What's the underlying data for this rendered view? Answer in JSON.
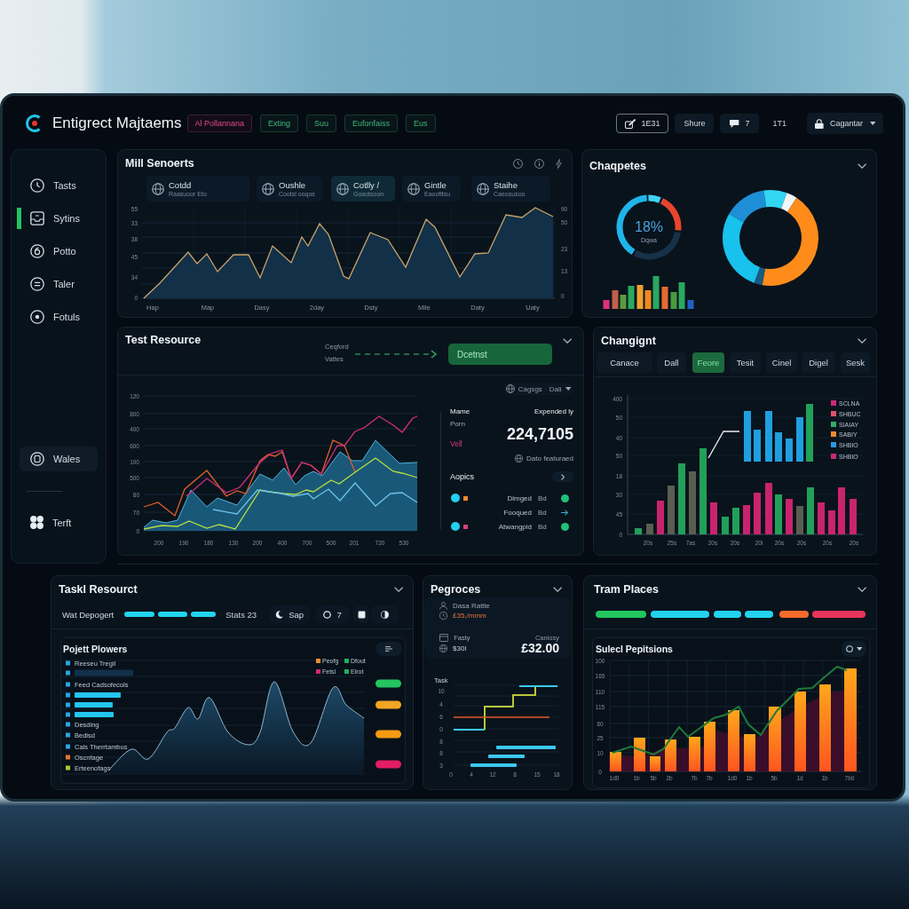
{
  "header": {
    "title": "Entigrect Majtaems",
    "tabs": [
      {
        "label": "Al Pollannana",
        "selected": true
      },
      {
        "label": "Exting",
        "selected": false
      },
      {
        "label": "Suu",
        "selected": false
      },
      {
        "label": "Eufonfaiss",
        "selected": false
      },
      {
        "label": "Eus",
        "selected": false
      }
    ],
    "toolbar": [
      {
        "kind": "outlined",
        "label": "1E31"
      },
      {
        "kind": "plain",
        "label": "Shure"
      },
      {
        "kind": "chat",
        "label": "7"
      },
      {
        "kind": "text",
        "label": "1T1"
      }
    ],
    "user_menu": {
      "label": "Cagantar"
    }
  },
  "sidebar": {
    "items": [
      {
        "label": "Tasts",
        "selected": false
      },
      {
        "label": "Sytins",
        "selected": true
      },
      {
        "label": "Potto",
        "selected": false
      },
      {
        "label": "Taler",
        "selected": false
      },
      {
        "label": "Fotuls",
        "selected": false
      }
    ],
    "bottom_items": [
      {
        "label": "Wales",
        "selected": true
      },
      {
        "label": "Terft",
        "selected": false
      }
    ]
  },
  "sensor_panel": {
    "title": "Mill Senoerts",
    "stats": [
      {
        "label": "Cotdd",
        "caption": "Raasuoor Eto",
        "selected": false
      },
      {
        "label": "Oushle",
        "caption": "Cootsl ooqos",
        "selected": false
      },
      {
        "label": "Cotlly /",
        "caption": "Goaotsoon",
        "selected": true
      },
      {
        "label": "Gintle",
        "caption": "Eaoofitsu",
        "selected": false
      },
      {
        "label": "Staihe",
        "caption": "Caeosusoo",
        "selected": false
      }
    ],
    "chart": {
      "y_ticks": [
        "55",
        "33",
        "38",
        "45",
        "34",
        "0"
      ],
      "y2_ticks": [
        "90",
        "50",
        "23",
        "13",
        "0"
      ],
      "x_labels": [
        "Hap",
        "Map",
        "Dasy",
        "2day",
        "Dsty",
        "Mile",
        "Daty",
        "Uaty"
      ]
    }
  },
  "chapter_panel": {
    "title": "Chaqpetes",
    "gauge": {
      "value": "18%",
      "caption": "Dqwa"
    }
  },
  "resource_panel": {
    "title": "Test Resource",
    "flow_labels": [
      "Ceqford",
      "Vattes"
    ],
    "action": "Dcetnst",
    "chart": {
      "y_ticks": [
        "120",
        "800",
        "400",
        "600",
        "100",
        "500",
        "80",
        "70",
        "0"
      ],
      "x_labels": [
        "200",
        "190",
        "180",
        "130",
        "200",
        "400",
        "700",
        "500",
        "201",
        "720",
        "530"
      ]
    },
    "filter": {
      "label": "Cagsgs",
      "value": "Dali"
    },
    "summary": {
      "name_label": "Mame",
      "column_label": "Expended ly",
      "name": "Porn",
      "status": "Vell",
      "amount": "224,7105",
      "note": "Dato featuraed"
    },
    "topics": {
      "title": "Aopics",
      "rows": [
        {
          "kind": "marked",
          "label": "Dimged",
          "value": "Bd",
          "color": "#f08a30"
        },
        {
          "kind": "plain",
          "label": "Fooqued",
          "value": "Bd"
        },
        {
          "kind": "marked",
          "label": "Atwangpid",
          "value": "Bd",
          "color": "#d8407a"
        }
      ]
    }
  },
  "change_panel": {
    "title": "Changignt",
    "tabs": [
      {
        "label": "Canace",
        "selected": false
      },
      {
        "label": "Dall",
        "selected": false
      },
      {
        "label": "Feore",
        "selected": true
      },
      {
        "label": "Tesit",
        "selected": false
      },
      {
        "label": "Cinel",
        "selected": false
      },
      {
        "label": "Digel",
        "selected": false
      },
      {
        "label": "Sesk",
        "selected": false
      }
    ],
    "chart": {
      "y_ticks": [
        "400",
        "50",
        "40",
        "50",
        "18",
        "30",
        "45",
        "0"
      ],
      "x_labels": [
        "20s",
        "25s",
        "7as",
        "20s",
        "20s",
        "20l",
        "20s",
        "20s",
        "20s",
        "20s"
      ],
      "legend": [
        {
          "label": "SCLNA",
          "color": "#d0287a"
        },
        {
          "label": "SHBUC",
          "color": "#e0506a"
        },
        {
          "label": "SIAIAY",
          "color": "#2fb062"
        },
        {
          "label": "SABIY",
          "color": "#f08a30"
        },
        {
          "label": "SHBIO",
          "color": "#2a9ad8"
        },
        {
          "label": "SHBIO",
          "color": "#c82a78"
        }
      ]
    }
  },
  "task_panel": {
    "title": "Taskl Resourct",
    "filter_label": "Wat Depogert",
    "status": "Stats 23",
    "segments": [
      {
        "kind": "moon",
        "label": "Sap"
      },
      {
        "kind": "ring",
        "label": "7"
      },
      {
        "kind": "square"
      },
      {
        "kind": "half"
      }
    ],
    "chart": {
      "title": "Pojett Plowers",
      "list": [
        {
          "kind": "text",
          "label": "Reeseu Tregil",
          "color": "#2aa6de"
        },
        {
          "kind": "track",
          "color": "#2aa6de"
        },
        {
          "kind": "text",
          "label": "Feed Cadsofecols",
          "color": "#2aa6de"
        },
        {
          "kind": "bar",
          "color": "#2aa6de"
        },
        {
          "kind": "bar",
          "color": "#2aa6de"
        },
        {
          "kind": "bar",
          "color": "#2aa6de"
        },
        {
          "kind": "text",
          "label": "Desding",
          "color": "#2aa6de"
        },
        {
          "kind": "text",
          "label": "Bedisd",
          "color": "#2aa6de"
        },
        {
          "kind": "text",
          "label": "Cals Therrtambus",
          "color": "#2aa6de"
        },
        {
          "kind": "text",
          "label": "Oscnfage",
          "color": "#e0782e"
        },
        {
          "kind": "text",
          "label": "Erteenofags",
          "color": "#a6c832"
        }
      ],
      "legend": [
        {
          "label": "Peofg",
          "color": "#f08a30"
        },
        {
          "label": "Dfout",
          "color": "#22b060"
        },
        {
          "label": "Fetsl",
          "color": "#d02a6a"
        },
        {
          "label": "Elrot",
          "color": "#22b060"
        }
      ],
      "markers": [
        {
          "color": "#22c55e"
        },
        {
          "color": "#f5a524"
        },
        {
          "color": "#f59a12"
        },
        {
          "color": "#e11d63"
        }
      ]
    }
  },
  "progress_panel": {
    "title": "Pegroces",
    "card": {
      "name": "Dasa Rattle",
      "price": "£35,/mmm",
      "label": "Fasty",
      "caption": "Caniosy",
      "code": "$30I",
      "amount": "£32.00"
    },
    "chart": {
      "title": "Task",
      "y_ticks": [
        "10",
        "4",
        "6",
        "0",
        "8",
        "8",
        "3"
      ],
      "x_ticks": [
        "0",
        "4",
        "12",
        "8",
        "15",
        "18"
      ]
    }
  },
  "team_panel": {
    "title": "Tram Places",
    "pills": [
      {
        "color": "#22c55e"
      },
      {
        "color": "#22d3ee"
      },
      {
        "color": "#22d3ee"
      },
      {
        "color": "#22d3ee"
      },
      {
        "color": "#f26b2a"
      },
      {
        "color": "#e8345a"
      }
    ],
    "chart": {
      "title": "Sulecl Pepitsions",
      "y_ticks": [
        "100",
        "165",
        "110",
        "115",
        "60",
        "25",
        "10",
        "0"
      ],
      "x_labels": [
        "1d0",
        "1b",
        "5b",
        "2b",
        "7b",
        "7b",
        "1d0",
        "1b",
        "5b",
        "1d",
        "1b",
        "7b0"
      ]
    }
  }
}
